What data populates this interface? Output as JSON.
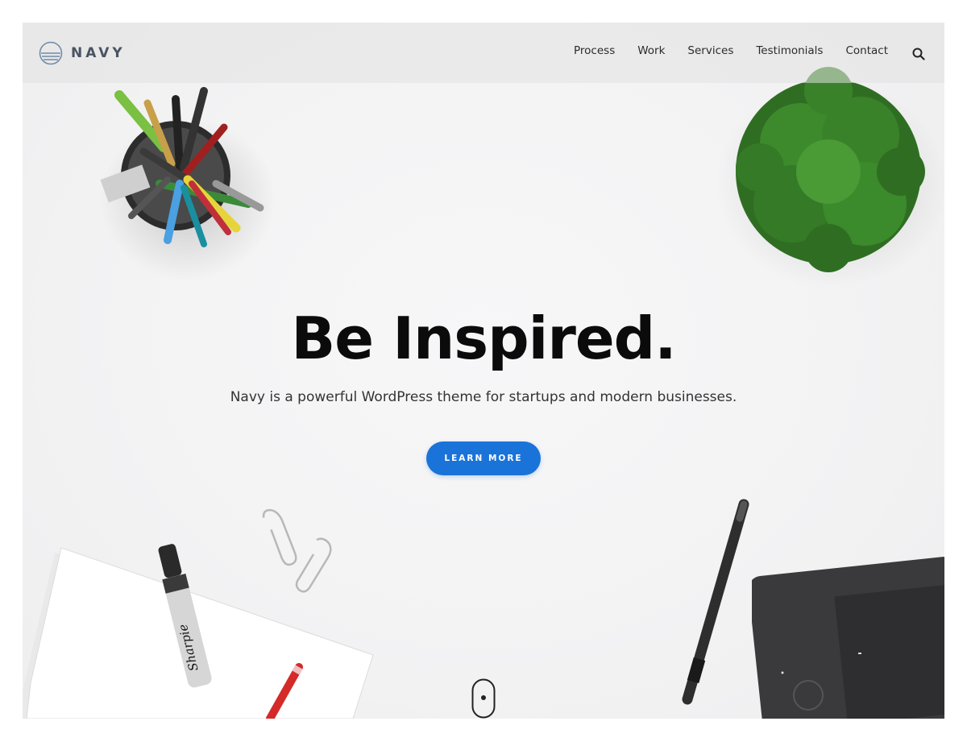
{
  "brand": {
    "name": "NAVY",
    "logo_icon": "striped-circle-logo",
    "text_color": "#4a5461"
  },
  "nav": {
    "items": [
      {
        "label": "Process"
      },
      {
        "label": "Work"
      },
      {
        "label": "Services"
      },
      {
        "label": "Testimonials"
      },
      {
        "label": "Contact"
      }
    ],
    "search_icon": "search-icon"
  },
  "hero": {
    "title": "Be Inspired.",
    "subtitle": "Navy is a powerful WordPress theme for startups and modern businesses.",
    "cta_label": "LEARN MORE",
    "cta_color": "#1a73d8"
  },
  "decor": {
    "items": [
      "pen-cup-icon",
      "potted-plant-icon",
      "paper-stack-icon",
      "sharpie-marker-icon",
      "red-pencil-icon",
      "paperclip-icon",
      "stylus-pen-icon",
      "drawing-tablet-icon"
    ],
    "marker_brand": "Sharpie"
  },
  "scroll_indicator_icon": "mouse-scroll-icon"
}
